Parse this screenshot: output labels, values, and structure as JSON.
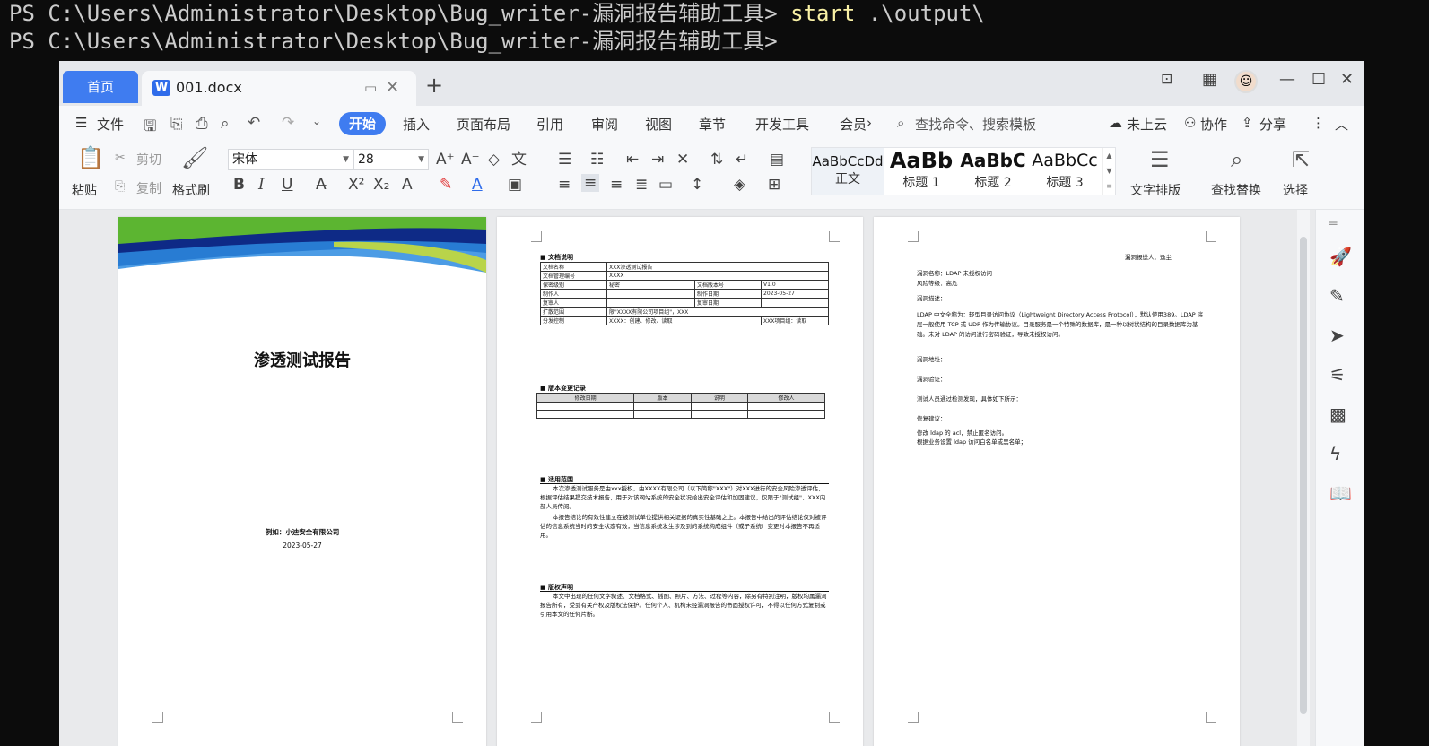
{
  "terminal": {
    "line1_prompt": "PS C:\\Users\\Administrator\\Desktop\\Bug_writer-漏洞报告辅助工具>",
    "line1_cmd": "start",
    "line1_arg": ".\\output\\",
    "line2_prompt": "PS C:\\Users\\Administrator\\Desktop\\Bug_writer-漏洞报告辅助工具>"
  },
  "tabs": {
    "home": "首页",
    "doc": "001.docx",
    "doc_icon": "W"
  },
  "menu": {
    "file": "文件",
    "start": "开始",
    "insert": "插入",
    "layout": "页面布局",
    "ref": "引用",
    "review": "审阅",
    "view": "视图",
    "chapter": "章节",
    "devtools": "开发工具",
    "member": "会员",
    "search": "查找命令、搜索模板",
    "cloud": "未上云",
    "collab": "协作",
    "share": "分享"
  },
  "ribbon": {
    "paste": "粘贴",
    "cut": "剪切",
    "copy": "复制",
    "format_painter": "格式刷",
    "font": "宋体",
    "size": "28",
    "styles": [
      {
        "sample": "AaBbCcDd",
        "name": "正文"
      },
      {
        "sample": "AaBb",
        "name": "标题 1"
      },
      {
        "sample": "AaBbC",
        "name": "标题 2"
      },
      {
        "sample": "AaBbCc",
        "name": "标题 3"
      }
    ],
    "text_layout": "文字排版",
    "find_replace": "查找替换",
    "select": "选择"
  },
  "page1": {
    "title": "渗透测试报告",
    "company": "例如：小迪安全有限公司",
    "date": "2023-05-27"
  },
  "page2": {
    "sec1": "■ 文档说明",
    "doc_table": [
      [
        "文档名称",
        "XXX渗透测试报告",
        "",
        ""
      ],
      [
        "文档管理编号",
        "XXXX",
        "",
        ""
      ],
      [
        "保密级别",
        "秘密",
        "文档版本号",
        "V1.0"
      ],
      [
        "制作人",
        "",
        "制作日期",
        "2023-05-27"
      ],
      [
        "复审人",
        "",
        "复审日期",
        ""
      ],
      [
        "扩散范围",
        "限\"XXXX有限公司项目组\"，XXX",
        "",
        ""
      ],
      [
        "分发控制",
        "XXXX：创建、修改、读取",
        "XXX项目组：读取",
        ""
      ]
    ],
    "sec2": "■ 版本变更记录",
    "ver_headers": [
      "修改日期",
      "版本",
      "说明",
      "修改人"
    ],
    "sec3": "■ 适用范围",
    "scope1": "本次渗透测试服务是由xxx授权，由XXXX有限公司（以下简称\"XXX\"）对XXX进行的安全风险渗透评估，根据评估结果提交技术报告，用于对该网站系统的安全状况给出安全评估和加固建议，仅限于\"测试组\"、XXX内部人员传阅。",
    "scope2": "本报告结论的有效性建立在被测试单位提供相关证据的真实性基础之上。本报告中给出的评估结论仅对被评估的信息系统当时的安全状态有效，当信息系统发生涉及到的系统构成组件（或子系统）变更时本报告不再适用。",
    "sec4": "■ 版权声明",
    "copyright": "本文中出现的任何文字叙述、文档格式、插图、照片、方法、过程等内容，除另有特别注明，版权均属漏洞报告所有，受到有关产权及版权法保护。任何个人、机构未经漏洞报告的书面授权许可，不得以任何方式复制或引用本文的任何片断。"
  },
  "page3": {
    "reporter": "漏洞报送人：逸尘",
    "vuln_name": "漏洞名称：LDAP 未授权访问",
    "risk": "风险等级：高危",
    "desc_h": "漏洞描述：",
    "desc": "LDAP 中文全称为：轻型目录访问协议（Lightweight Directory Access Protocol），默认使用389。LDAP 底层一般使用 TCP 或 UDP 作为传输协议。目录服务是一个特殊的数据库，是一种以树状结构的目录数据库为基础。未对 LDAP 的访问进行密码验证，导致未授权访问。",
    "addr": "漏洞地址：",
    "verify": "漏洞验证：",
    "tested": "测试人员通过检测发现，具体如下所示：",
    "fix_h": "修复建议：",
    "fix1": "修改 ldap 的 acl，禁止匿名访问。",
    "fix2": "根据业务设置 ldap 访问白名单或黑名单；"
  }
}
